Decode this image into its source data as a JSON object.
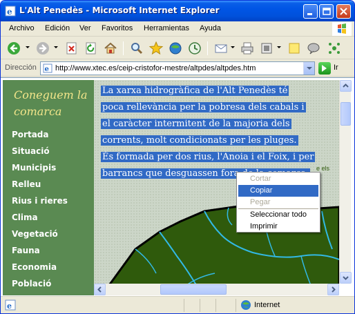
{
  "window": {
    "title": "L'Alt Penedès - Microsoft Internet Explorer"
  },
  "menubar": {
    "items": [
      "Archivo",
      "Edición",
      "Ver",
      "Favoritos",
      "Herramientas",
      "Ayuda"
    ]
  },
  "address": {
    "label": "Dirección",
    "url": "http://www.xtec.es/ceip-cristofor-mestre/altpdes/altpdes.htm",
    "go_label": "Ir"
  },
  "sidebar": {
    "heading": "Coneguem la comarca",
    "links": [
      "Portada",
      "Situació",
      "Municipis",
      "Relleu",
      "Rius i rieres",
      "Clima",
      "Vegetació",
      "Fauna",
      "Economia",
      "Població"
    ]
  },
  "main": {
    "lines": [
      "La xarxa hidrogràfica de l'Alt Penedès té",
      "poca rellevància per la pobresa dels cabals i",
      "el caràcter intermitent de la majoria dels",
      "corrents, molt condicionats per les pluges.",
      "És formada per dos rius, l'Anoia i el Foix, i per",
      "barrancs que desguassen fora de la comarca."
    ],
    "map_label_fragment": "e els"
  },
  "context_menu": {
    "items": [
      {
        "label": "Cortar",
        "state": "disabled"
      },
      {
        "label": "Copiar",
        "state": "hover"
      },
      {
        "label": "Pegar",
        "state": "disabled"
      },
      {
        "label": "Seleccionar todo",
        "state": "enabled"
      },
      {
        "label": "Imprimir",
        "state": "enabled"
      }
    ]
  },
  "statusbar": {
    "zone": "Internet"
  },
  "colors": {
    "selection": "#316ac5",
    "sidebar_bg": "#5a8a52",
    "heading": "#f2e58a",
    "map_land": "#2f5a0c",
    "rivers": "#32b9e6"
  }
}
